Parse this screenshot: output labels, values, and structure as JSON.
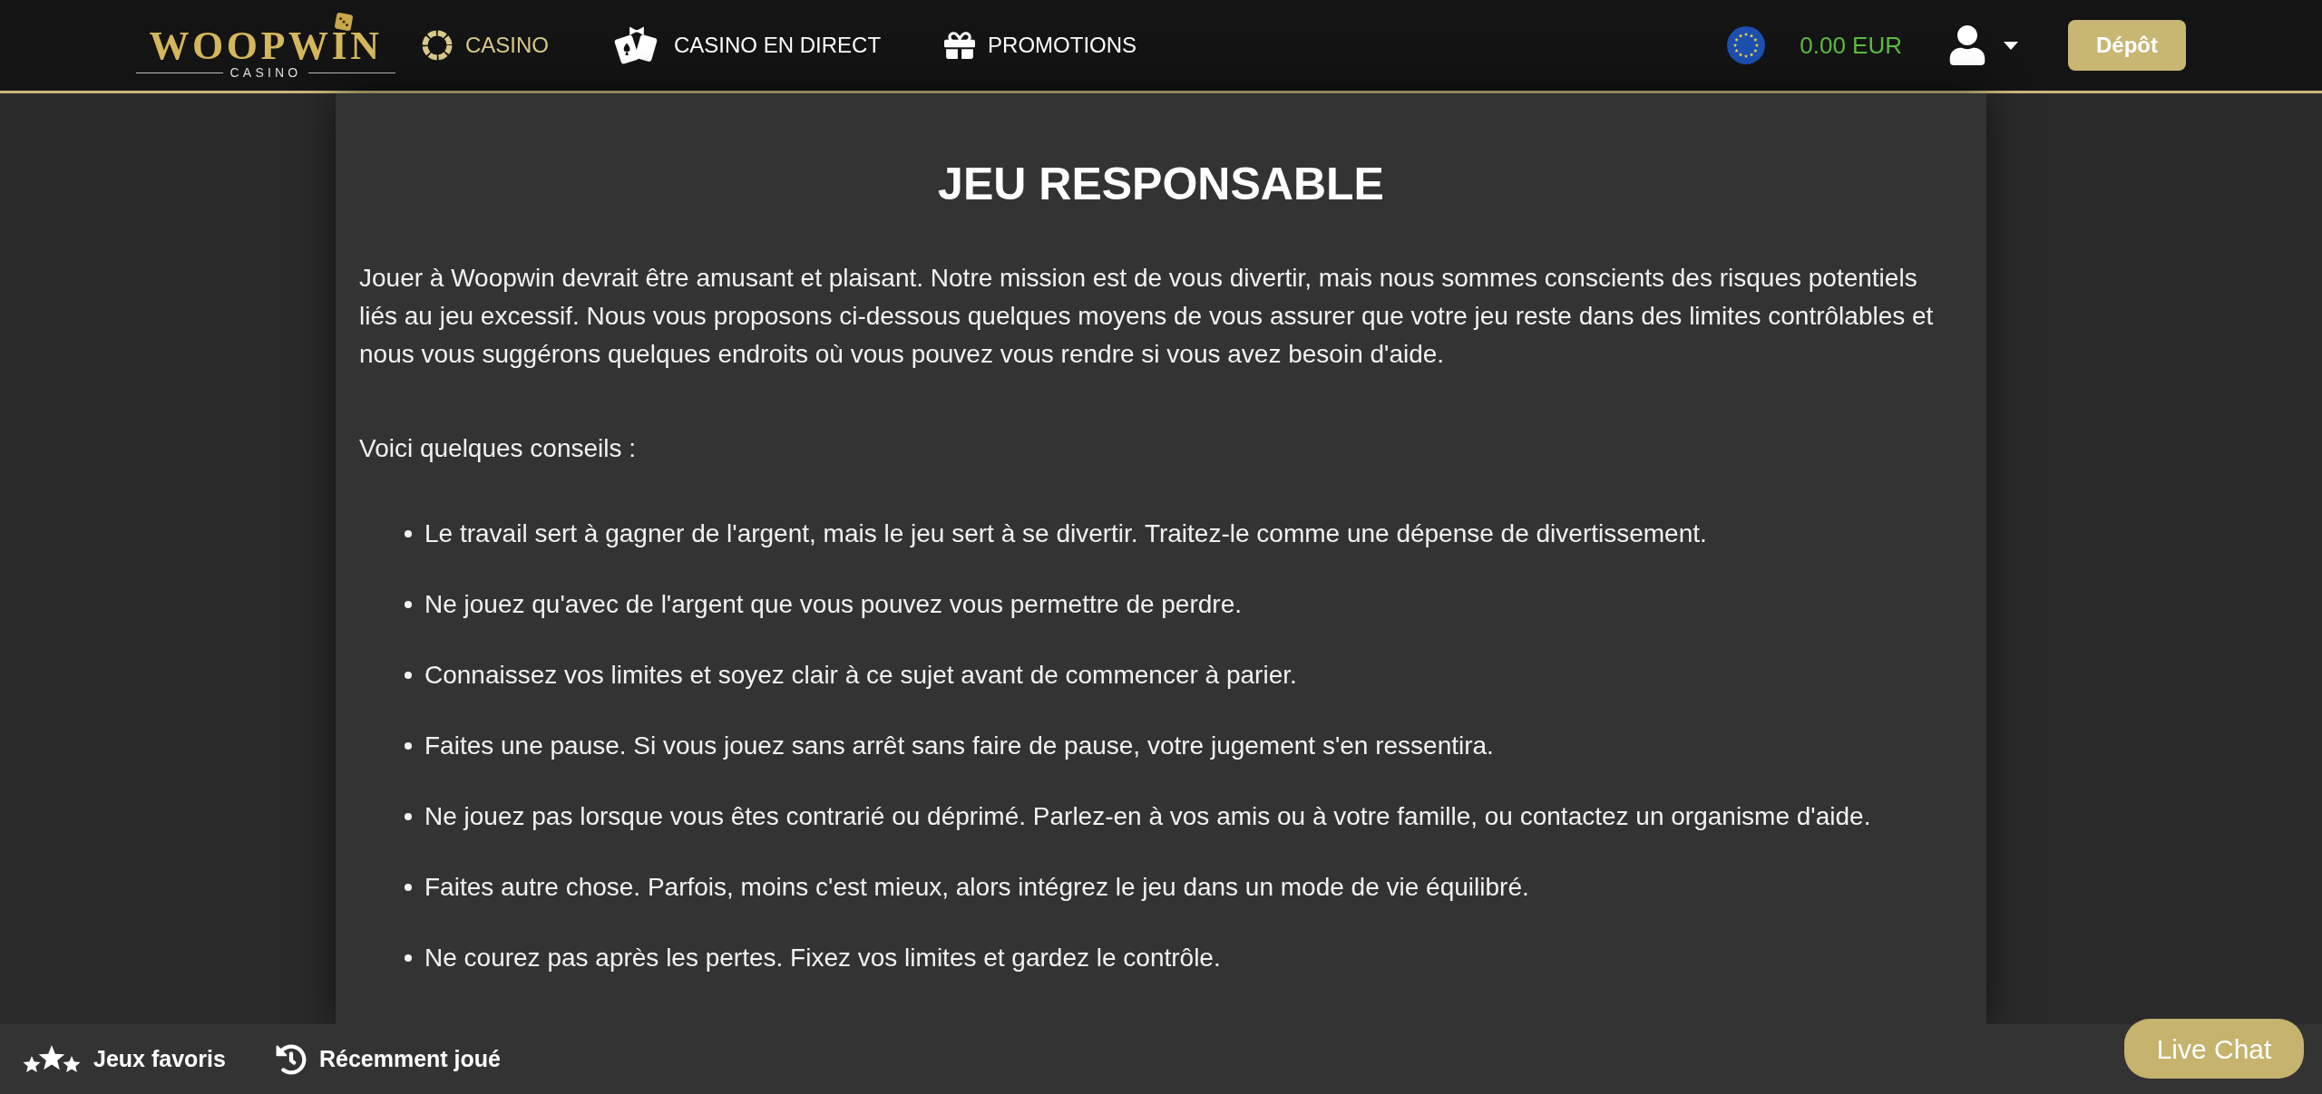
{
  "header": {
    "logo": {
      "wordmark": "WOOPWIN",
      "tagline": "CASINO"
    },
    "nav": [
      {
        "label": "CASINO",
        "selected": true
      },
      {
        "label": "CASINO EN DIRECT",
        "selected": false
      },
      {
        "label": "PROMOTIONS",
        "selected": false
      }
    ],
    "balance": "0.00 EUR",
    "deposit_button": "Dépôt"
  },
  "page": {
    "title": "JEU RESPONSABLE",
    "intro": "Jouer à Woopwin devrait être amusant et plaisant. Notre mission est de vous divertir, mais nous sommes conscients des risques potentiels liés au jeu excessif. Nous vous proposons ci-dessous quelques moyens de vous assurer que votre jeu reste dans des limites contrôlables et nous vous suggérons quelques endroits où vous pouvez vous rendre si vous avez besoin d'aide.",
    "tips_heading": "Voici quelques conseils :",
    "tips": [
      "Le travail sert à gagner de l'argent, mais le jeu sert à se divertir. Traitez-le comme une dépense de divertissement.",
      "Ne jouez qu'avec de l'argent que vous pouvez vous permettre de perdre.",
      "Connaissez vos limites et soyez clair à ce sujet avant de commencer à parier.",
      "Faites une pause. Si vous jouez sans arrêt sans faire de pause, votre jugement s'en ressentira.",
      "Ne jouez pas lorsque vous êtes contrarié ou déprimé. Parlez-en à vos amis ou à votre famille, ou contactez un organisme d'aide.",
      "Faites autre chose. Parfois, moins c'est mieux, alors intégrez le jeu dans un mode de vie équilibré.",
      "Ne courez pas après les pertes. Fixez vos limites et gardez le contrôle."
    ]
  },
  "bottom_bar": {
    "items": [
      {
        "label": "Jeux favoris"
      },
      {
        "label": "Récemment joué"
      }
    ]
  },
  "live_chat_button": "Live Chat"
}
